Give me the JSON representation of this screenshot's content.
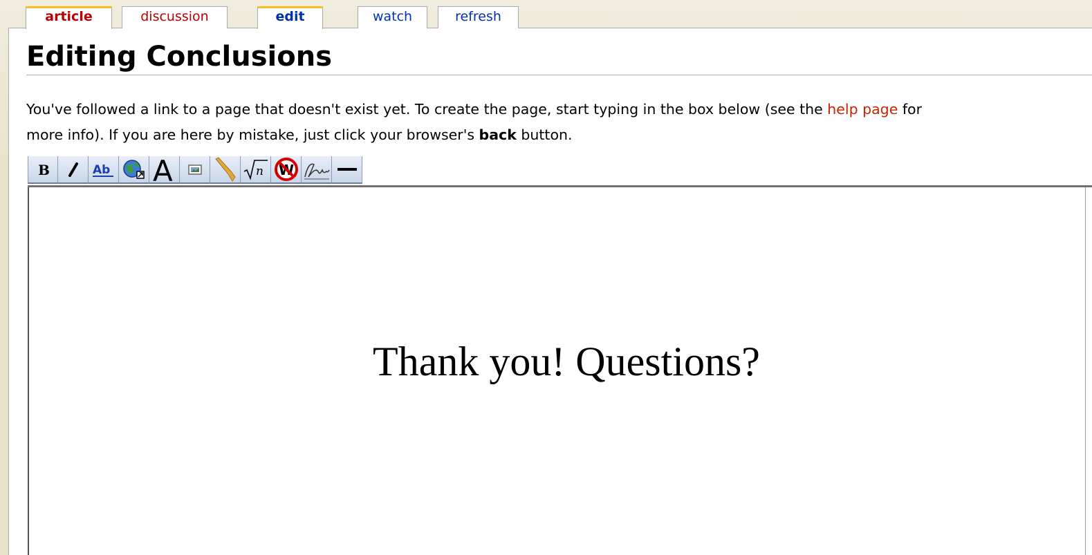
{
  "tabs": [
    {
      "label": "article",
      "color": "#ba0000",
      "selected": true
    },
    {
      "label": "discussion",
      "color": "#ba0000",
      "selected": false
    },
    {
      "label": "edit",
      "color": "#0033aa",
      "selected": true
    },
    {
      "label": "watch",
      "color": "#0033aa",
      "selected": false
    },
    {
      "label": "refresh",
      "color": "#0033aa",
      "selected": false
    }
  ],
  "page_title": "Editing Conclusions",
  "intro": {
    "line1_before_link": "You've followed a link to a page that doesn't exist yet. To create the page, start typing in the box below (see the ",
    "link_text": "help page",
    "line1_after_link": " for",
    "line2_before_bold": "more info). If you are here by mistake, just click your browser's ",
    "bold_text": "back",
    "line2_after_bold": " button."
  },
  "toolbar": {
    "buttons": [
      {
        "icon": "bold-icon"
      },
      {
        "icon": "italic-icon"
      },
      {
        "icon": "internal-link-icon"
      },
      {
        "icon": "external-link-icon"
      },
      {
        "icon": "headline-icon"
      },
      {
        "icon": "image-icon"
      },
      {
        "icon": "media-icon"
      },
      {
        "icon": "math-formula-icon"
      },
      {
        "icon": "nowiki-icon"
      },
      {
        "icon": "signature-icon"
      },
      {
        "icon": "horizontal-line-icon"
      }
    ]
  },
  "editor": {
    "content": "Thank you! Questions?"
  },
  "colors": {
    "link_red": "#cc2200",
    "tab_blue": "#0033aa",
    "tab_selected_accent": "#fabd23",
    "background": "#e9e3cd"
  }
}
